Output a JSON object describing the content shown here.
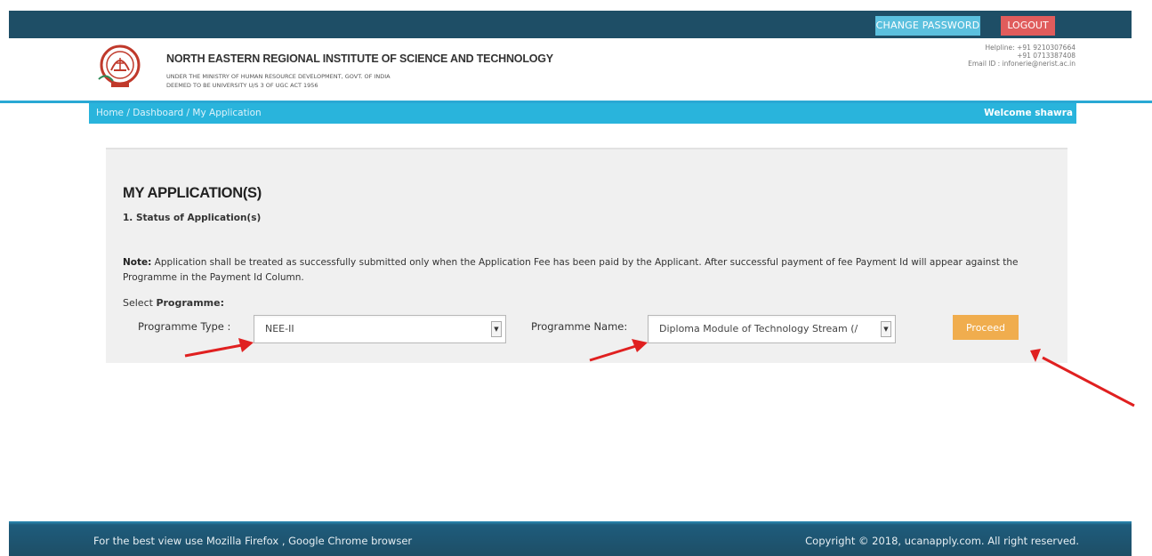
{
  "topbar": {
    "change_password": "CHANGE PASSWORD",
    "logout": "LOGOUT"
  },
  "header": {
    "institute_name": "NORTH EASTERN REGIONAL INSTITUTE OF SCIENCE AND TECHNOLOGY",
    "sub1": "UNDER THE MINISTRY OF HUMAN RESOURCE DEVELOPMENT, GOVT. OF INDIA",
    "sub2": "DEEMED TO BE UNIVERSITY U/S 3 OF UGC ACT 1956",
    "helpline": "Helpline: +91 9210307664",
    "helpline2": "+91 0713387408",
    "email": "Email ID : infonerie@nerist.ac.in"
  },
  "nav": {
    "breadcrumb": "Home  /  Dashboard  /  My Application",
    "welcome": "Welcome shawra"
  },
  "main": {
    "title": "MY APPLICATION(S)",
    "subtitle": "1. Status of Application(s)",
    "note_label": "Note:",
    "note_text": " Application shall be treated as successfully submitted only when the Application Fee has been paid by the Applicant. After successful payment of fee Payment Id will appear against the Programme in the Payment Id Column.",
    "select_programme_prefix": "Select ",
    "select_programme_bold": "Programme:",
    "programme_type_label": "Programme Type :",
    "programme_type_value": "NEE-II",
    "programme_name_label": "Programme Name:",
    "programme_name_value": "Diploma Module of Technology Stream (/",
    "proceed": "Proceed"
  },
  "footer": {
    "left": "For the best view use Mozilla Firefox , Google Chrome browser",
    "right": "Copyright © 2018, ucanapply.com. All right reserved."
  },
  "colors": {
    "topbar": "#1e4e66",
    "navbar": "#29b4dc",
    "change_password": "#5bc0de",
    "logout": "#e05c5c",
    "proceed": "#f0ad4e",
    "annotation_arrow": "#e02020"
  },
  "icons": {
    "logo": "institute-emblem-icon",
    "select_arrow": "dropdown-arrow-icon"
  }
}
